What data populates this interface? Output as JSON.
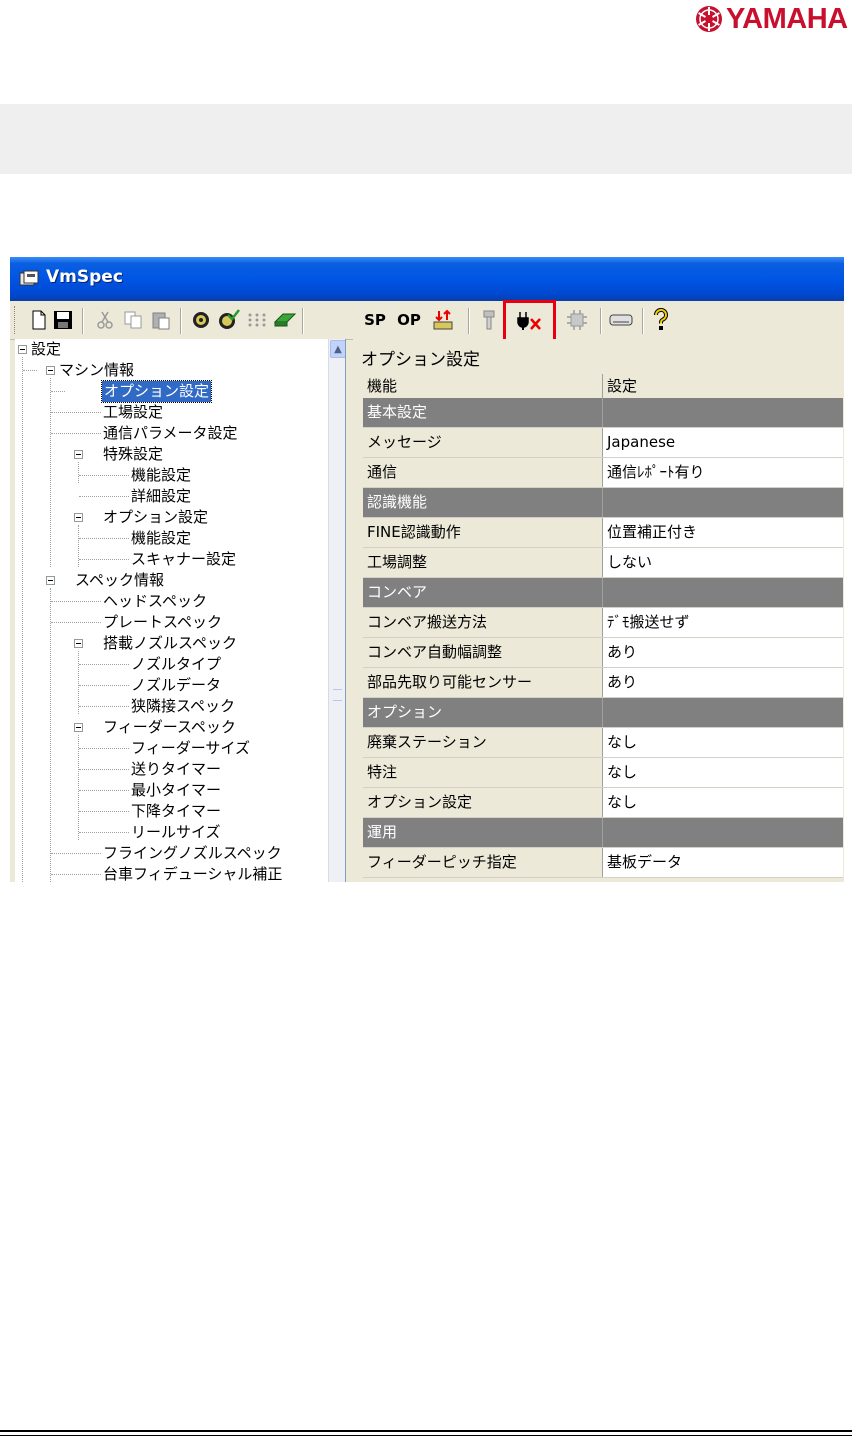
{
  "logo": {
    "text": "YAMAHA",
    "colors": {
      "brand": "#c8102e"
    }
  },
  "window": {
    "title": "VmSpec",
    "title_icon": "vmspec-app-icon"
  },
  "toolbar": {
    "buttons": [
      {
        "icon": "new-document-icon"
      },
      {
        "icon": "save-icon"
      },
      {
        "icon": "cut-icon"
      },
      {
        "icon": "copy-icon"
      },
      {
        "icon": "paste-icon"
      },
      {
        "icon": "reel-icon"
      },
      {
        "icon": "reel-check-icon"
      },
      {
        "icon": "dot-grid-icon"
      },
      {
        "icon": "pcb-board-icon"
      },
      {
        "label": "SP"
      },
      {
        "label": "OP"
      },
      {
        "icon": "transfer-arrows-icon"
      },
      {
        "icon": "nozzle-icon"
      },
      {
        "icon": "plug-disconnect-icon"
      },
      {
        "icon": "chip-icon"
      },
      {
        "icon": "card-slot-icon"
      },
      {
        "icon": "help-icon"
      }
    ],
    "highlight_color": "#e60012"
  },
  "tree": {
    "nodes": [
      {
        "label": "設定"
      },
      {
        "label": "マシン情報"
      },
      {
        "label": "オプション設定"
      },
      {
        "label": "工場設定"
      },
      {
        "label": "通信パラメータ設定"
      },
      {
        "label": "特殊設定"
      },
      {
        "label": "機能設定"
      },
      {
        "label": "詳細設定"
      },
      {
        "label": "オプション設定"
      },
      {
        "label": "機能設定"
      },
      {
        "label": "スキャナー設定"
      },
      {
        "label": "スペック情報"
      },
      {
        "label": "ヘッドスペック"
      },
      {
        "label": "プレートスペック"
      },
      {
        "label": "搭載ノズルスペック"
      },
      {
        "label": "ノズルタイプ"
      },
      {
        "label": "ノズルデータ"
      },
      {
        "label": "狭隣接スペック"
      },
      {
        "label": "フィーダースペック"
      },
      {
        "label": "フィーダーサイズ"
      },
      {
        "label": "送りタイマー"
      },
      {
        "label": "最小タイマー"
      },
      {
        "label": "下降タイマー"
      },
      {
        "label": "リールサイズ"
      },
      {
        "label": "フライングノズルスペック"
      },
      {
        "label": "台車フィデューシャル補正"
      }
    ]
  },
  "panel": {
    "title": "オプション設定",
    "columns": [
      "機能",
      "設定"
    ],
    "rows": [
      {
        "kind": "section",
        "name": "基本設定",
        "value": ""
      },
      {
        "kind": "item",
        "name": "メッセージ",
        "value": "Japanese"
      },
      {
        "kind": "item",
        "name": "通信",
        "value": "通信ﾚﾎﾟｰﾄ有り"
      },
      {
        "kind": "section",
        "name": "認識機能",
        "value": ""
      },
      {
        "kind": "item",
        "name": "FINE認識動作",
        "value": "位置補正付き"
      },
      {
        "kind": "item",
        "name": "工場調整",
        "value": "しない"
      },
      {
        "kind": "section",
        "name": "コンベア",
        "value": ""
      },
      {
        "kind": "item",
        "name": "コンベア搬送方法",
        "value": "ﾃﾞﾓ搬送せず"
      },
      {
        "kind": "item",
        "name": "コンベア自動幅調整",
        "value": "あり"
      },
      {
        "kind": "item",
        "name": "部品先取り可能センサー",
        "value": "あり"
      },
      {
        "kind": "section",
        "name": "オプション",
        "value": ""
      },
      {
        "kind": "item",
        "name": "廃棄ステーション",
        "value": "なし"
      },
      {
        "kind": "item",
        "name": "特注",
        "value": "なし"
      },
      {
        "kind": "item",
        "name": "オプション設定",
        "value": "なし"
      },
      {
        "kind": "section",
        "name": "運用",
        "value": ""
      },
      {
        "kind": "item",
        "name": "フィーダーピッチ指定",
        "value": "基板データ"
      }
    ]
  }
}
